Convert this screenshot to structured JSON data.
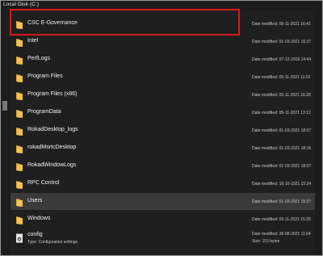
{
  "header": {
    "title": "Local Disk (C:)"
  },
  "labels": {
    "date_modified": "Date modified:",
    "type": "Type:",
    "size": "Size:"
  },
  "colors": {
    "folder": "#f2c14e",
    "folder_dark": "#d9a23a",
    "highlight": "#d41a1a"
  },
  "icons": {
    "folder": "folder-icon",
    "file": "settings-file-icon"
  },
  "items": [
    {
      "name": "CSC E-Governance",
      "date": "08-11-2021 16:41"
    },
    {
      "name": "Intel",
      "date": "01-03-2021 16:37"
    },
    {
      "name": "PerfLogs",
      "date": "07-12-2019 14:44"
    },
    {
      "name": "Program Files",
      "date": "05-11-2021 11:01"
    },
    {
      "name": "Program Files (x86)",
      "date": "05-11-2021 16:28"
    },
    {
      "name": "ProgramData",
      "date": "05-11-2021 13:12"
    },
    {
      "name": "RokadDesktop_logs",
      "date": "01-03-2021 18:07"
    },
    {
      "name": "rokadMsrtcDesktop",
      "date": "01-03-2021 18:16"
    },
    {
      "name": "RokadWindowLogs",
      "date": "01-03-2021 18:07"
    },
    {
      "name": "RPC Control",
      "date": "16-10-2021 15:34"
    },
    {
      "name": "Users",
      "date": "01-03-2021 15:27"
    },
    {
      "name": "Windows",
      "date": "02-11-2021 15:26"
    }
  ],
  "config_item": {
    "name": "config",
    "date": "26-08-2021 11:04",
    "type": "Configuration settings",
    "size": "153 bytes"
  }
}
